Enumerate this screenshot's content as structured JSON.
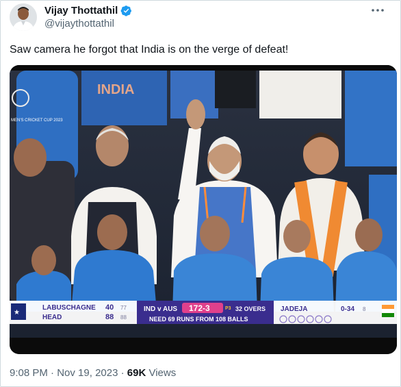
{
  "author": {
    "display_name": "Vijay Thottathil",
    "handle": "@vijaythottathil"
  },
  "tweet": {
    "text": "Saw camera he forgot that India is on the verge of defeat!"
  },
  "media": {
    "banner_jersey_text": "INDIA",
    "banner_logo_text": "MEN'S CRICKET CUP 2023",
    "scoreboard": {
      "batter1_name": "LABUSCHAGNE",
      "batter1_runs": "40",
      "batter1_balls": "77",
      "batter2_name": "HEAD",
      "batter2_runs": "88",
      "batter2_balls": "88",
      "match": "IND v AUS",
      "score": "172-3",
      "powerplay": "P3",
      "overs": "32 OVERS",
      "target": "NEED 69 RUNS FROM 108 BALLS",
      "bowler_name": "JADEJA",
      "bowler_figures": "0-34",
      "bowler_overs": "8"
    }
  },
  "meta": {
    "time": "9:08 PM",
    "separator": " · ",
    "date": "Nov 19, 2023",
    "views_count": "69K",
    "views_label": " Views"
  },
  "colors": {
    "verified_blue": "#1d9bf0",
    "india_blue": "#2f6fc2",
    "scoreboard_purple": "#3a2d8e",
    "score_pink": "#e0408c"
  }
}
